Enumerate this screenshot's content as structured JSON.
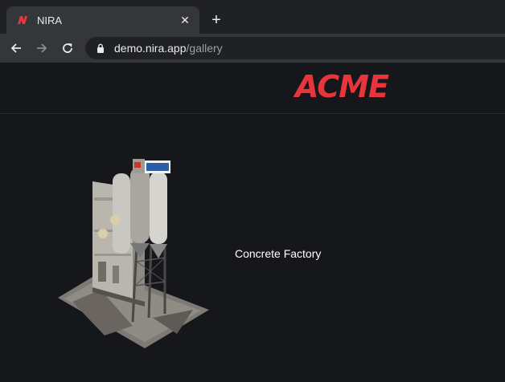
{
  "browser": {
    "tab": {
      "title": "NIRA",
      "favicon": "nira-logo-icon"
    },
    "new_tab_symbol": "+",
    "close_symbol": "✕",
    "address": {
      "host": "demo.nira.app",
      "path": "/gallery"
    }
  },
  "page": {
    "logo": "ACME",
    "gallery": [
      {
        "label": "Concrete Factory",
        "thumbnail": "concrete-factory-3d-model"
      }
    ]
  },
  "colors": {
    "brand": "#e8353b",
    "background": "#16171b",
    "tabstrip": "#202124",
    "toolbar": "#35363a"
  }
}
